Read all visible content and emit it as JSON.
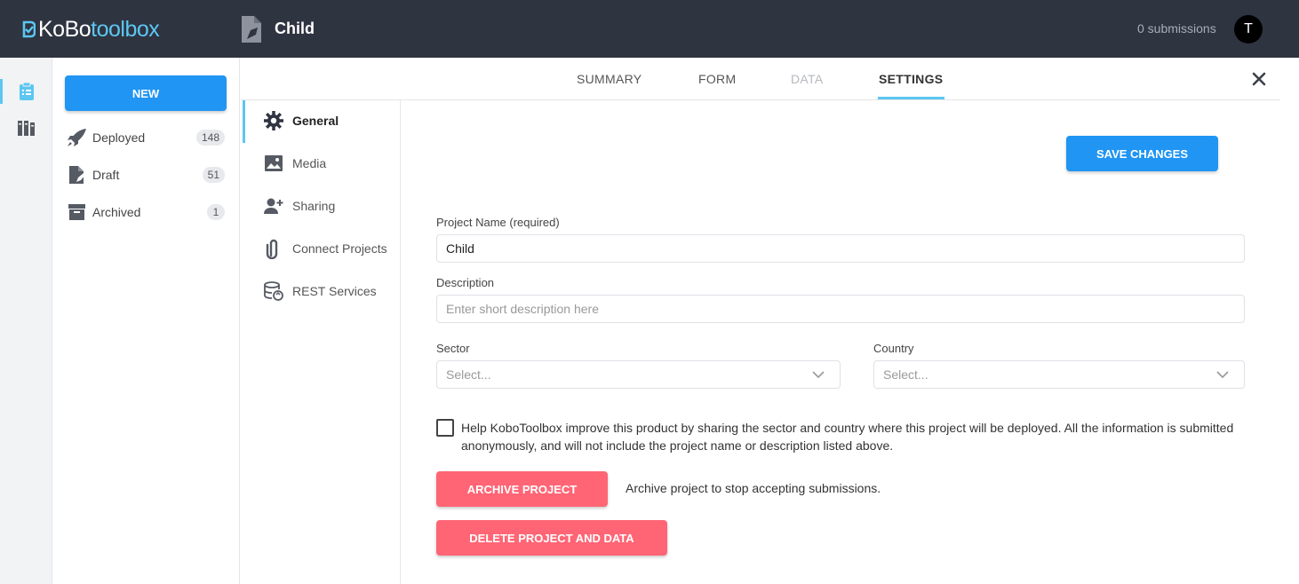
{
  "header": {
    "logo_kobo": "KoBo",
    "logo_toolbox": "toolbox",
    "project_title": "Child",
    "submissions": "0 submissions",
    "avatar_initial": "T"
  },
  "sidebar": {
    "new_button": "NEW",
    "items": [
      {
        "label": "Deployed",
        "count": "148",
        "icon": "rocket-icon"
      },
      {
        "label": "Draft",
        "count": "51",
        "icon": "draft-icon"
      },
      {
        "label": "Archived",
        "count": "1",
        "icon": "archive-icon"
      }
    ]
  },
  "tabs": [
    {
      "label": "SUMMARY",
      "state": "normal"
    },
    {
      "label": "FORM",
      "state": "normal"
    },
    {
      "label": "DATA",
      "state": "disabled"
    },
    {
      "label": "SETTINGS",
      "state": "active"
    }
  ],
  "settings_nav": [
    {
      "label": "General",
      "icon": "gear-icon",
      "active": true
    },
    {
      "label": "Media",
      "icon": "image-icon",
      "active": false
    },
    {
      "label": "Sharing",
      "icon": "add-user-icon",
      "active": false
    },
    {
      "label": "Connect Projects",
      "icon": "paperclip-icon",
      "active": false
    },
    {
      "label": "REST Services",
      "icon": "database-sync-icon",
      "active": false
    }
  ],
  "form": {
    "save_button": "SAVE CHANGES",
    "project_name_label": "Project Name (required)",
    "project_name_value": "Child",
    "description_label": "Description",
    "description_placeholder": "Enter short description here",
    "sector_label": "Sector",
    "sector_placeholder": "Select...",
    "country_label": "Country",
    "country_placeholder": "Select...",
    "share_checkbox_text": "Help KoboToolbox improve this product by sharing the sector and country where this project will be deployed. All the information is submitted anonymously, and will not include the project name or description listed above.",
    "share_checkbox_checked": false,
    "archive_button": "ARCHIVE PROJECT",
    "archive_note": "Archive project to stop accepting submissions.",
    "delete_button": "DELETE PROJECT AND DATA"
  },
  "colors": {
    "topbar": "#2f3441",
    "accent": "#5cc7f1",
    "primary_button": "#2095f3",
    "danger_button": "#ff6575"
  }
}
